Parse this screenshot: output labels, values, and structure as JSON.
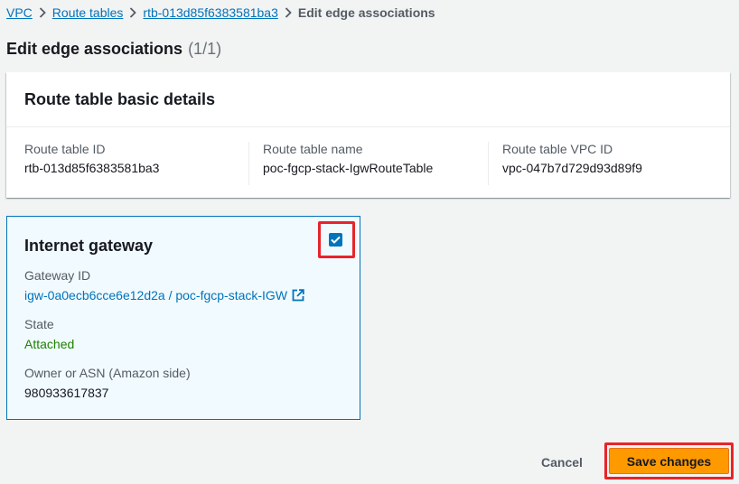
{
  "breadcrumb": {
    "items": [
      "VPC",
      "Route tables",
      "rtb-013d85f6383581ba3"
    ],
    "current": "Edit edge associations"
  },
  "page": {
    "title": "Edit edge associations",
    "count": "(1/1)"
  },
  "details": {
    "title": "Route table basic details",
    "fields": [
      {
        "label": "Route table ID",
        "value": "rtb-013d85f6383581ba3"
      },
      {
        "label": "Route table name",
        "value": "poc-fgcp-stack-IgwRouteTable"
      },
      {
        "label": "Route table VPC ID",
        "value": "vpc-047b7d729d93d89f9"
      }
    ]
  },
  "gateway": {
    "title": "Internet gateway",
    "checked": true,
    "gateway_id_label": "Gateway ID",
    "gateway_id_value": "igw-0a0ecb6cce6e12d2a / poc-fgcp-stack-IGW",
    "state_label": "State",
    "state_value": "Attached",
    "owner_label": "Owner or ASN (Amazon side)",
    "owner_value": "980933617837"
  },
  "actions": {
    "cancel_label": "Cancel",
    "save_label": "Save changes"
  },
  "colors": {
    "link": "#0073bb",
    "attached": "#1d8102",
    "primary_button": "#ff9900",
    "highlight": "#e8242a"
  }
}
